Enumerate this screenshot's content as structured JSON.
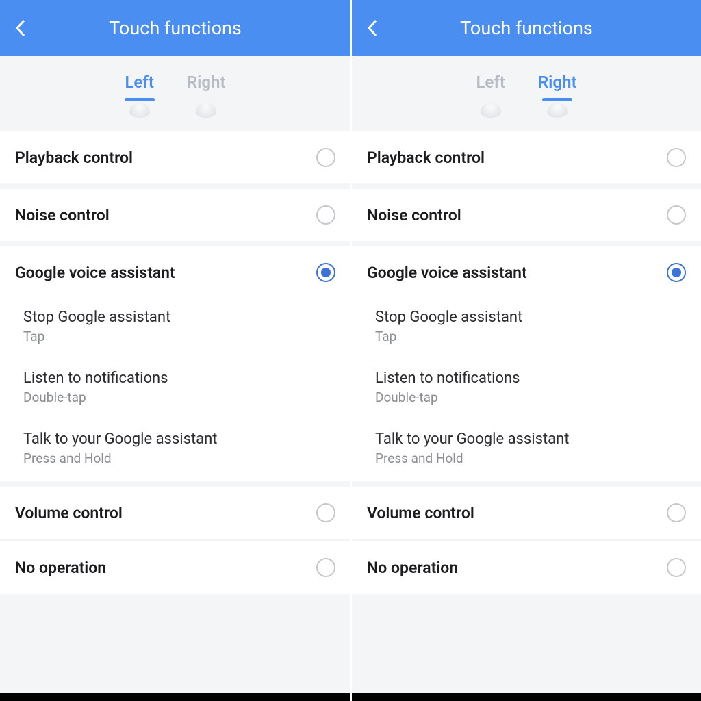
{
  "colors": {
    "accent": "#4b8ef1",
    "radio": "#3b73d9"
  },
  "header": {
    "title": "Touch functions"
  },
  "tabs": {
    "left": "Left",
    "right": "Right"
  },
  "options": {
    "playback": "Playback control",
    "noise": "Noise control",
    "assistant": "Google voice assistant",
    "volume": "Volume control",
    "none": "No operation"
  },
  "assistant_sub": {
    "stop": {
      "title": "Stop Google assistant",
      "gesture": "Tap"
    },
    "listen": {
      "title": "Listen to notifications",
      "gesture": "Double-tap"
    },
    "talk": {
      "title": "Talk to your Google assistant",
      "gesture": "Press and Hold"
    }
  },
  "panels": [
    {
      "active_tab": "left",
      "selected": "assistant"
    },
    {
      "active_tab": "right",
      "selected": "assistant"
    }
  ]
}
